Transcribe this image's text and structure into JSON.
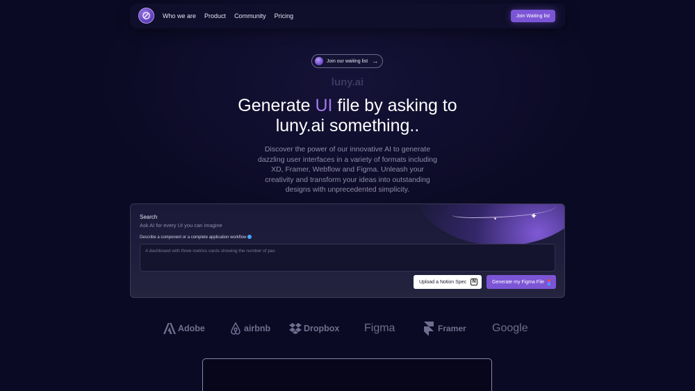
{
  "nav": {
    "links": [
      "Who we are",
      "Product",
      "Community",
      "Pricing"
    ],
    "cta_label": "Join Waiting list"
  },
  "hero": {
    "pill_text": "Join our waiting list",
    "brand": "luny.ai",
    "headline_pre": "Generate ",
    "headline_accent": "UI",
    "headline_post": " file by asking to",
    "headline_line2": "luny.ai something..",
    "subtext": "Discover the power of our innovative AI to generate dazzling user interfaces in a variety of formats including XD, Framer, Webflow and Figma. Unleash your creativity and transform your ideas into outstanding designs with unprecedented simplicity."
  },
  "search": {
    "title": "Search",
    "subtitle": "Ask AI for every UI you can imagine",
    "label": "Describe a component or a complete application workflow",
    "placeholder": "A dashboard with three metrics cards showing the number of pas",
    "notion_button": "Upload a Notion Spec",
    "figma_button": "Generate my Figma File"
  },
  "logos": [
    "Adobe",
    "airbnb",
    "Dropbox",
    "Figma",
    "Framer",
    "Google"
  ],
  "colors": {
    "background": "#0b0a24",
    "accent": "#7b55d6",
    "accent_text": "#a07cf0",
    "logo_gray": "#6f6e8e"
  },
  "icons": {
    "logo": "compass-logo-icon",
    "pill": "avatar-icon",
    "arrow": "arrow-right-icon",
    "notion": "notion-icon",
    "figma": "figma-icon",
    "sparkle": "sparkle-icon"
  }
}
